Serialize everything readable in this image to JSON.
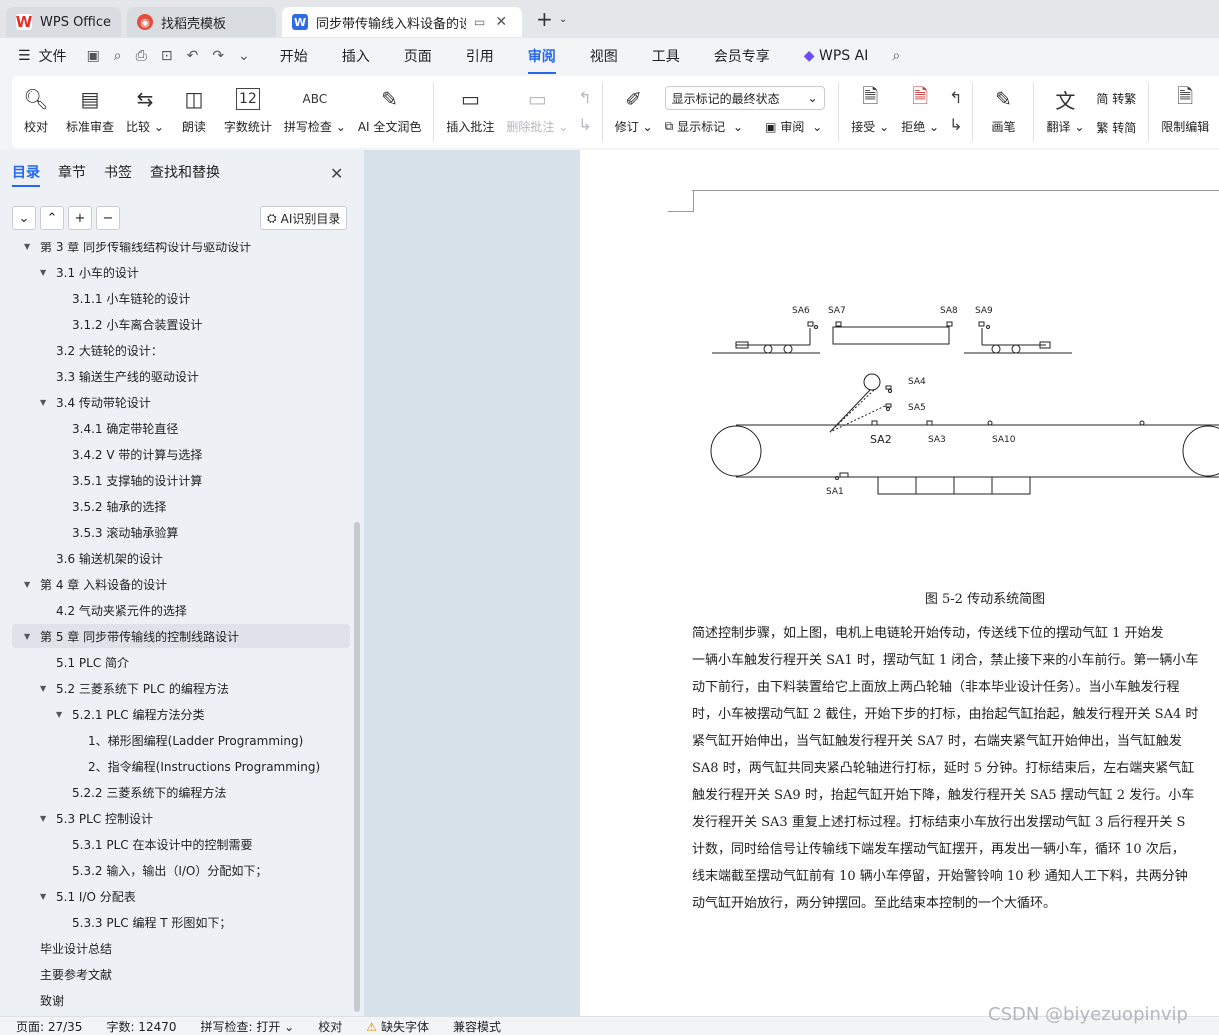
{
  "tabs": [
    {
      "label": "WPS Office",
      "icon": "wps-logo-icon"
    },
    {
      "label": "找稻壳模板",
      "icon": "docer-logo-icon"
    },
    {
      "label": "同步带传输线入料设备的设计",
      "icon": "writer-doc-icon",
      "active": true
    }
  ],
  "menu": {
    "file": "文件",
    "items": [
      "开始",
      "插入",
      "页面",
      "引用",
      "审阅",
      "视图",
      "工具",
      "会员专享"
    ],
    "active": "审阅",
    "wps_ai": "WPS AI"
  },
  "ribbon": {
    "proofread": "校对",
    "std_review": "标准审查",
    "compare": "比较",
    "read_aloud": "朗读",
    "word_count": "字数统计",
    "spell_check": "拼写检查",
    "ai_proofread": "AI 全文润色",
    "insert_comment": "插入批注",
    "delete_comment": "删除批注",
    "revise": "修订",
    "display_state": "显示标记的最终状态",
    "show_markup": "显示标记",
    "review": "审阅",
    "accept": "接受",
    "reject": "拒绝",
    "draw": "画笔",
    "translate": "翻译",
    "to_trad": "简 转繁",
    "to_simp": "繁 转简",
    "restrict_edit": "限制编辑"
  },
  "nav": {
    "tabs": [
      "目录",
      "章节",
      "书签",
      "查找和替换"
    ],
    "active": "目录",
    "ai_button": "AI识别目录",
    "items": [
      {
        "text": "第 3 章  同步传输线结构设计与驱动设计",
        "level": 0,
        "arrow": "down"
      },
      {
        "text": "3.1 小车的设计",
        "level": 1,
        "arrow": "down"
      },
      {
        "text": "3.1.1 小车链轮的设计",
        "level": 2
      },
      {
        "text": "3.1.2 小车离合装置设计",
        "level": 2
      },
      {
        "text": "3.2 大链轮的设计：",
        "level": 1
      },
      {
        "text": "3.3    输送生产线的驱动设计",
        "level": 1
      },
      {
        "text": "3.4  传动带轮设计",
        "level": 1,
        "arrow": "down"
      },
      {
        "text": "3.4.1 确定带轮直径",
        "level": 2
      },
      {
        "text": "3.4.2    V 带的计算与选择",
        "level": 2
      },
      {
        "text": "3.5.1    支撑轴的设计计算",
        "level": 2
      },
      {
        "text": "3.5.2 轴承的选择",
        "level": 2
      },
      {
        "text": "3.5.3 滚动轴承验算",
        "level": 2
      },
      {
        "text": "3.6 输送机架的设计",
        "level": 1
      },
      {
        "text": "第 4 章    入料设备的设计",
        "level": 0,
        "arrow": "down"
      },
      {
        "text": "4.2 气动夹紧元件的选择",
        "level": 1
      },
      {
        "text": "第 5 章    同步带传输线的控制线路设计",
        "level": 0,
        "arrow": "down",
        "selected": true
      },
      {
        "text": "5.1 PLC 简介",
        "level": 1
      },
      {
        "text": "5.2 三菱系统下 PLC 的编程方法",
        "level": 1,
        "arrow": "down"
      },
      {
        "text": "5.2.1 PLC 编程方法分类",
        "level": 2,
        "arrow": "down"
      },
      {
        "text": "1、梯形图编程(Ladder Programming)",
        "level": 3
      },
      {
        "text": "2、指令编程(Instructions Programming)",
        "level": 3
      },
      {
        "text": "5.2.2  三菱系统下的编程方法",
        "level": 2
      },
      {
        "text": "5.3 PLC 控制设计",
        "level": 1,
        "arrow": "down"
      },
      {
        "text": "5.3.1    PLC 在本设计中的控制需要",
        "level": 2
      },
      {
        "text": "5.3.2 输入，输出（I/O）分配如下；",
        "level": 2
      },
      {
        "text": "5.1    I/O 分配表",
        "level": 1,
        "arrow": "down"
      },
      {
        "text": "5.3.3 PLC 编程 T 形图如下；",
        "level": 2
      },
      {
        "text": "毕业设计总结",
        "level": 0
      },
      {
        "text": "主要参考文献",
        "level": 0
      },
      {
        "text": "致谢",
        "level": 0
      }
    ]
  },
  "document": {
    "diagram_labels": {
      "sa6": "SA6",
      "sa7": "SA7",
      "sa8": "SA8",
      "sa9": "SA9",
      "sa4": "SA4",
      "sa5": "SA5",
      "sa2": "SA2",
      "sa3": "SA3",
      "sa10": "SA10",
      "sa1": "SA1"
    },
    "caption": "图 5-2 传动系统简图",
    "lines": [
      "        简述控制步骤，如上图，电机上电链轮开始传动，传送线下位的摆动气缸 1 开始发",
      "一辆小车触发行程开关 SA1 时，摆动气缸 1 闭合，禁止接下来的小车前行。第一辆小车",
      "动下前行，由下料装置给它上面放上两凸轮轴（非本毕业设计任务）。当小车触发行程",
      "时，小车被摆动气缸 2 截住，开始下步的打标，由抬起气缸抬起，触发行程开关 SA4 时",
      "紧气缸开始伸出，当气缸触发行程开关 SA7 时，右端夹紧气缸开始伸出，当气缸触发",
      "SA8 时，两气缸共同夹紧凸轮轴进行打标，延时 5 分钟。打标结束后，左右端夹紧气缸",
      "触发行程开关 SA9 时，抬起气缸开始下降，触发行程开关 SA5 摆动气缸 2 发行。小车",
      "发行程开关 SA3  重复上述打标过程。打标结束小车放行出发摆动气缸 3 后行程开关 S",
      "计数，同时给信号让传输线下端发车摆动气缸摆开，再发出一辆小车，循环 10 次后，",
      "线末端截至摆动气缸前有 10 辆小车停留，开始警铃响 10 秒    通知人工下料，共两分钟",
      "动气缸开始放行，两分钟摆回。至此结束本控制的一个大循环。"
    ]
  },
  "status": {
    "page": "页面: 27/35",
    "words": "字数: 12470",
    "spell": "拼写检查: 打开",
    "proof": "校对",
    "missing_font": "缺失字体",
    "compat": "兼容模式"
  },
  "watermark": "CSDN @biyezuopinvip"
}
